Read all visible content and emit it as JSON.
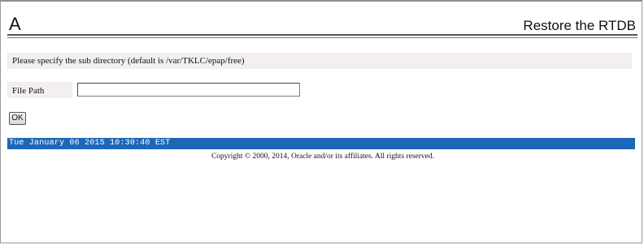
{
  "header": {
    "letter": "A",
    "title": "Restore the RTDB"
  },
  "form": {
    "instruction": "Please specify the sub directory (default is /var/TKLC/epap/free)",
    "file_path_label": "File Path",
    "file_path_value": "",
    "ok_label": "OK"
  },
  "status": {
    "timestamp": "Tue January 06 2015 10:30:40 EST"
  },
  "footer": {
    "copyright": "Copyright © 2000, 2014, Oracle and/or its affiliates. All rights reserved."
  },
  "colors": {
    "status_bar": "#1d67b8",
    "label_background": "#f2eef2"
  }
}
